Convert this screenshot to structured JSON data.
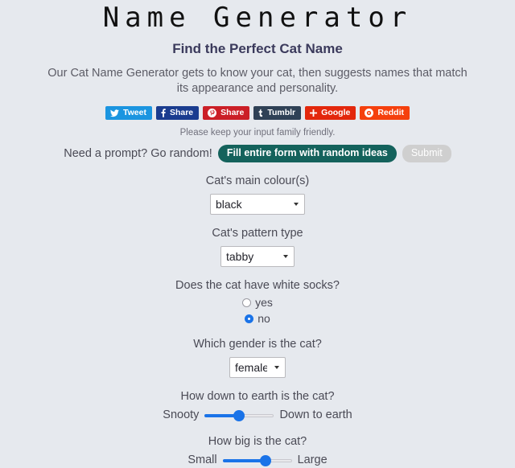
{
  "header": {
    "title": "Name Generator",
    "subtitle": "Find the Perfect Cat Name",
    "intro": "Our Cat Name Generator gets to know your cat, then suggests names that match its appearance and personality."
  },
  "social": {
    "buttons": [
      {
        "label": "Tweet",
        "icon": "twitter-icon",
        "color": "#1b95e0"
      },
      {
        "label": "Share",
        "icon": "facebook-icon",
        "color": "#1a3c8f"
      },
      {
        "label": "Share",
        "icon": "pinterest-icon",
        "color": "#cb1f27"
      },
      {
        "label": "Tumblr",
        "icon": "tumblr-icon",
        "color": "#2f4156"
      },
      {
        "label": "Google",
        "icon": "googleplus-icon",
        "color": "#e3270c"
      },
      {
        "label": "Reddit",
        "icon": "reddit-icon",
        "color": "#f5400d"
      }
    ]
  },
  "note": "Please keep your input family friendly.",
  "random": {
    "label": "Need a prompt? Go random!",
    "random_button": "Fill entire form with random ideas",
    "submit_button": "Submit",
    "accent_color": "#14625c",
    "submit_color": "#cfcfcf"
  },
  "form": {
    "colour": {
      "label": "Cat's main colour(s)",
      "value": "black",
      "options": [
        "black"
      ]
    },
    "pattern": {
      "label": "Cat's pattern type",
      "value": "tabby",
      "options": [
        "tabby"
      ]
    },
    "socks": {
      "label": "Does the cat have white socks?",
      "options": [
        {
          "label": "yes",
          "checked": false
        },
        {
          "label": "no",
          "checked": true
        }
      ]
    },
    "gender": {
      "label": "Which gender is the cat?",
      "value": "female",
      "options": [
        "female"
      ]
    },
    "down_to_earth": {
      "label": "How down to earth is the cat?",
      "min_label": "Snooty",
      "max_label": "Down to earth",
      "value": 50
    },
    "size": {
      "label": "How big is the cat?",
      "min_label": "Small",
      "max_label": "Large",
      "value": 62
    }
  },
  "colors": {
    "page_background": "#e6e9ee",
    "title": "#111111",
    "subtitle": "#3b3a5c",
    "body_text": "#4a4a55",
    "slider_accent": "#1a73e8"
  }
}
